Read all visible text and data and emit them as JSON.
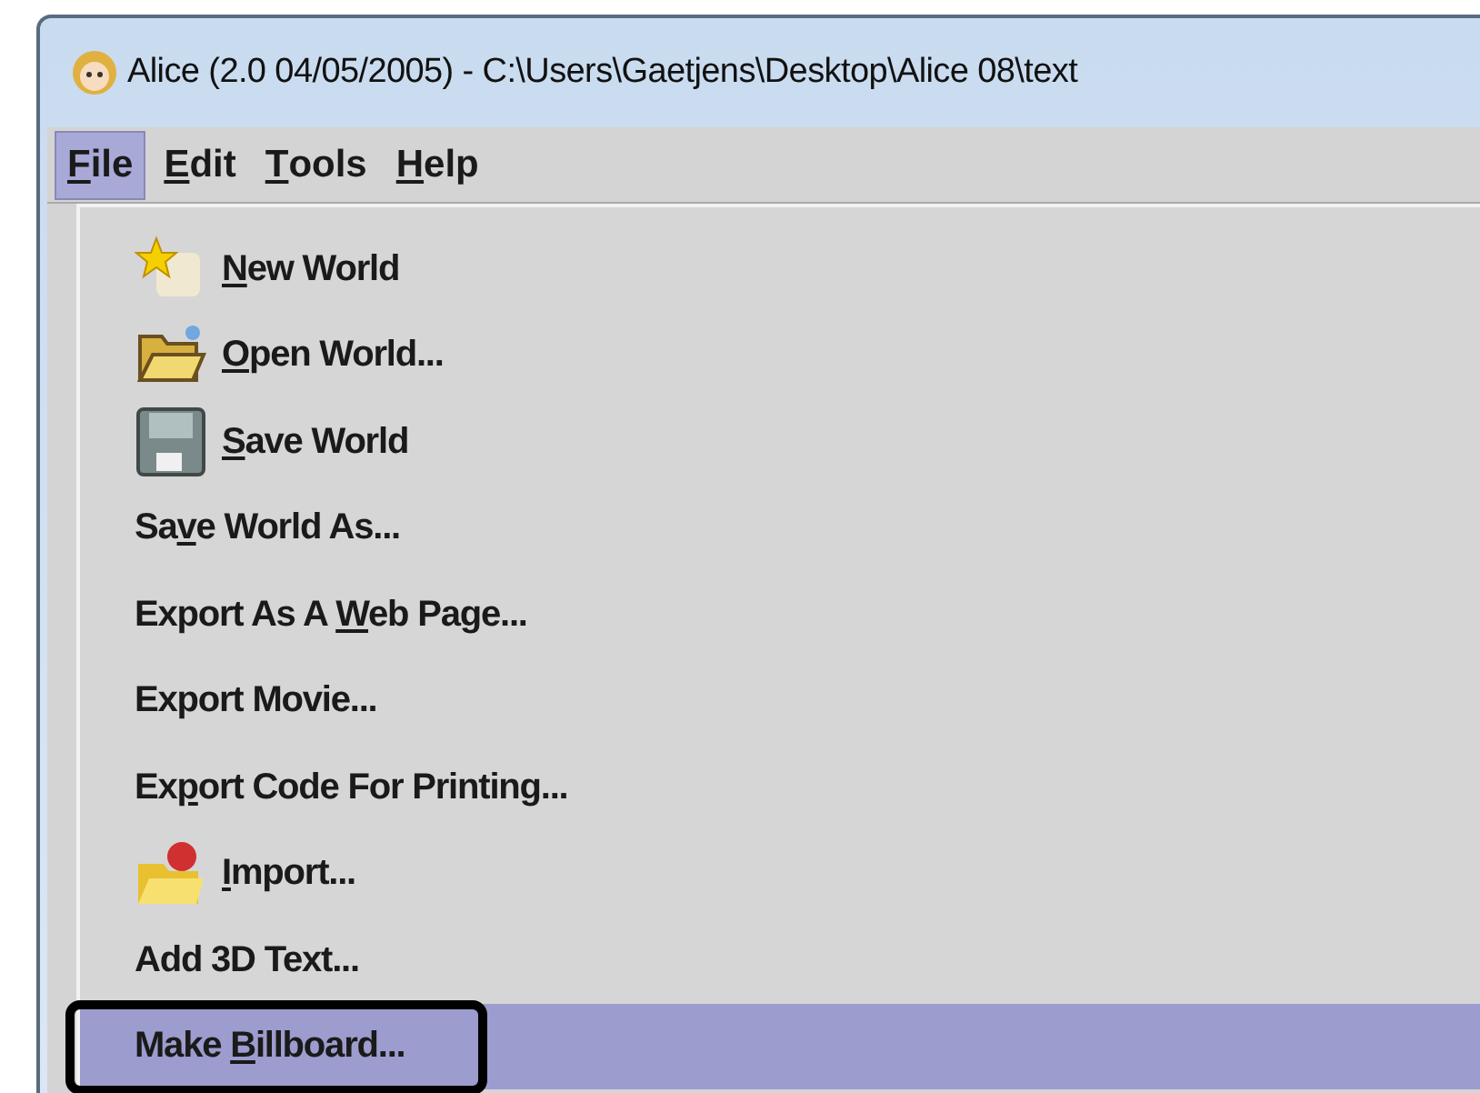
{
  "window": {
    "title": "Alice (2.0 04/05/2005) - C:\\Users\\Gaetjens\\Desktop\\Alice 08\\text"
  },
  "menubar": [
    {
      "key": "F",
      "post": "ile",
      "selected": true
    },
    {
      "key": "E",
      "post": "dit",
      "selected": false
    },
    {
      "key": "T",
      "post": "ools",
      "selected": false
    },
    {
      "key": "H",
      "post": "elp",
      "selected": false
    }
  ],
  "menu": [
    {
      "kind": "new",
      "key": "N",
      "post": "ew World",
      "selected": false,
      "annotated": false
    },
    {
      "kind": "open",
      "key": "O",
      "post": "pen World...",
      "selected": false,
      "annotated": false
    },
    {
      "kind": "save",
      "key": "S",
      "post": "ave World",
      "selected": false,
      "annotated": false
    },
    {
      "kind": "text",
      "pre": "Sa",
      "key": "v",
      "post": "e World As...",
      "selected": false,
      "annotated": false
    },
    {
      "kind": "text",
      "pre": "Export As A ",
      "key": "W",
      "post": "eb Page...",
      "selected": false,
      "annotated": false
    },
    {
      "kind": "text",
      "pre": "Export Movie...",
      "selected": false,
      "annotated": false
    },
    {
      "kind": "text",
      "pre": "Ex",
      "key": "p",
      "post": "ort Code For Printing...",
      "selected": false,
      "annotated": false
    },
    {
      "kind": "import",
      "key": "I",
      "post": "mport...",
      "selected": false,
      "annotated": false
    },
    {
      "kind": "text",
      "pre": "Add 3D Text...",
      "selected": false,
      "annotated": false
    },
    {
      "kind": "text",
      "pre": "Make ",
      "key": "B",
      "post": "illboard...",
      "selected": true,
      "annotated": true
    }
  ]
}
